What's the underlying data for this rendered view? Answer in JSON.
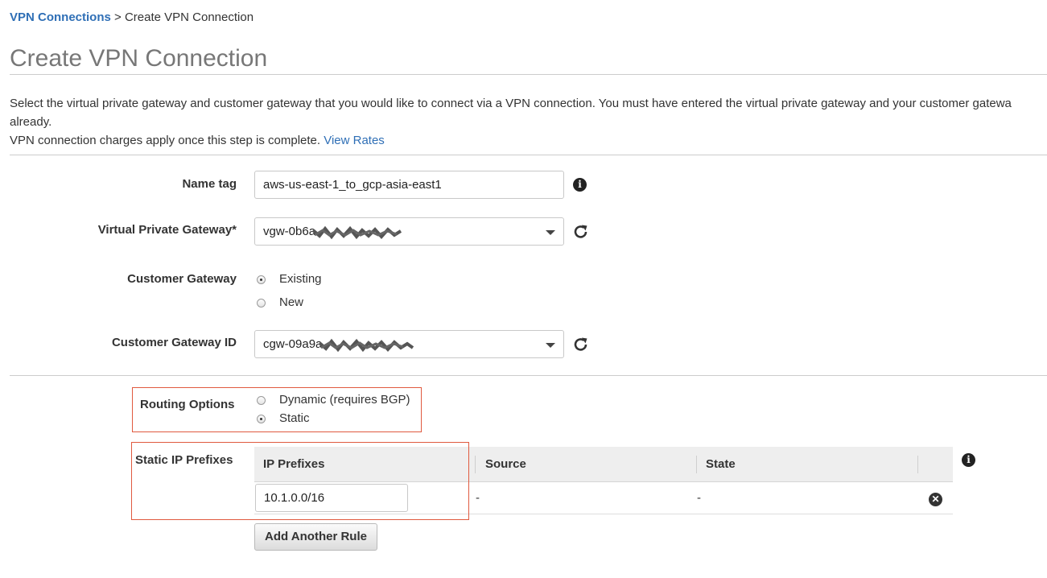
{
  "breadcrumb": {
    "parent": "VPN Connections",
    "separator": ">",
    "current": "Create VPN Connection"
  },
  "page_title": "Create VPN Connection",
  "description": {
    "line1": "Select the virtual private gateway and customer gateway that you would like to connect via a VPN connection. You must have entered the virtual private gateway and your customer gatewa",
    "line2": "already.",
    "line3": "VPN connection charges apply once this step is complete.",
    "link": "View Rates"
  },
  "form": {
    "name_tag": {
      "label": "Name tag",
      "value": "aws-us-east-1_to_gcp-asia-east1"
    },
    "vpg": {
      "label": "Virtual Private Gateway*",
      "value": "vgw-0b6a"
    },
    "customer_gateway": {
      "label": "Customer Gateway",
      "options": [
        "Existing",
        "New"
      ],
      "selected": "Existing"
    },
    "cgw_id": {
      "label": "Customer Gateway ID",
      "value": "cgw-09a9a"
    },
    "routing": {
      "label": "Routing Options",
      "options": [
        "Dynamic (requires BGP)",
        "Static"
      ],
      "selected": "Static"
    },
    "static_prefixes": {
      "label": "Static IP Prefixes",
      "columns": [
        "IP Prefixes",
        "Source",
        "State"
      ],
      "rows": [
        {
          "prefix": "10.1.0.0/16",
          "source": "-",
          "state": "-"
        }
      ],
      "add_button": "Add Another Rule"
    }
  },
  "icons": {
    "info": "info-icon",
    "refresh": "refresh-icon",
    "remove": "remove-circle-icon"
  },
  "colors": {
    "link": "#2f6fb6",
    "highlight_box": "#e05a3f",
    "title": "#777777"
  }
}
